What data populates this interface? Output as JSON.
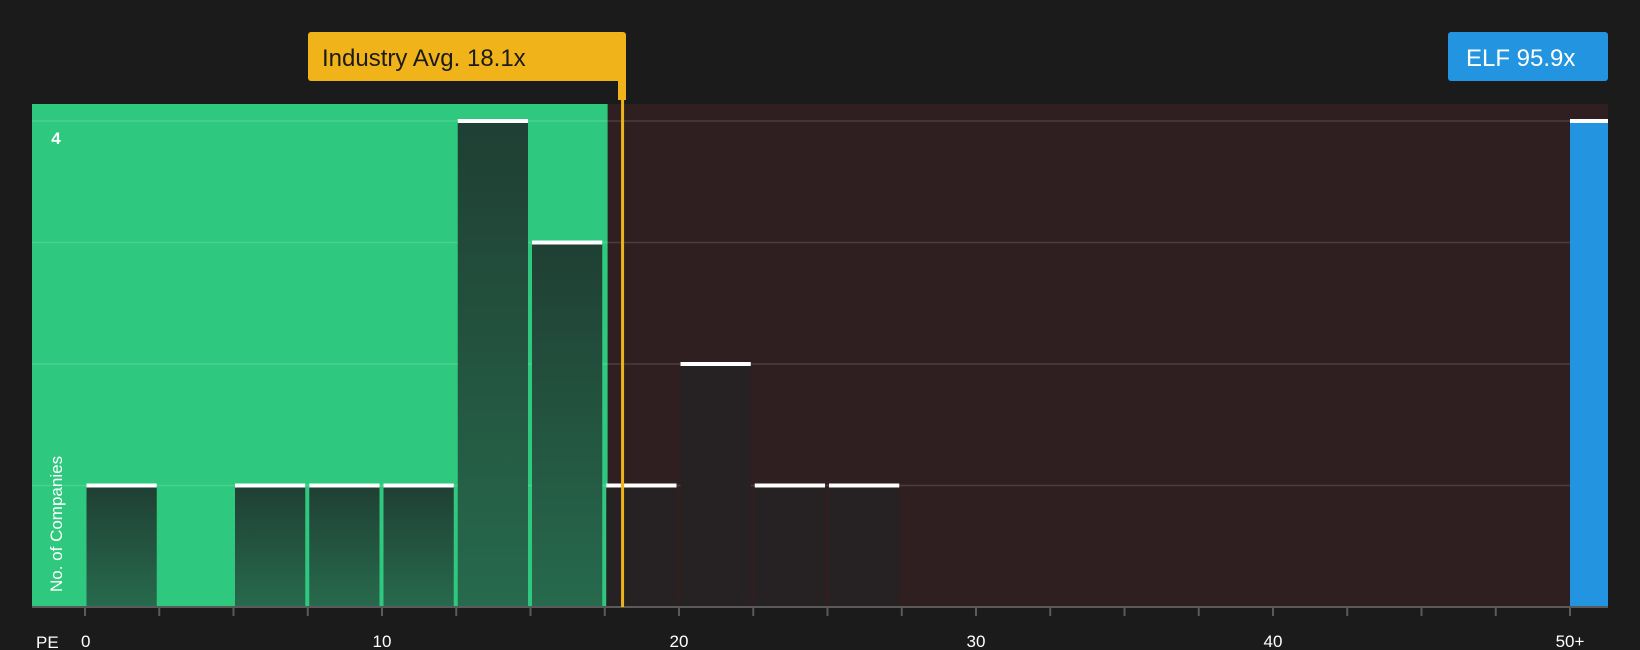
{
  "chart_data": {
    "type": "bar",
    "xlabel": "PE",
    "ylabel": "No. of Companies",
    "x_ticks": [
      {
        "value": 0,
        "label": "0"
      },
      {
        "value": 10,
        "label": "10"
      },
      {
        "value": 20,
        "label": "20"
      },
      {
        "value": 30,
        "label": "30"
      },
      {
        "value": 40,
        "label": "40"
      },
      {
        "value": 50,
        "label": "50+"
      }
    ],
    "xlim": [
      0,
      50
    ],
    "ylim": [
      0,
      4
    ],
    "y_tick_label": "4",
    "bin_width": 2.5,
    "bins": [
      {
        "start": 0,
        "count": 1
      },
      {
        "start": 2.5,
        "count": 0
      },
      {
        "start": 5,
        "count": 1
      },
      {
        "start": 7.5,
        "count": 1
      },
      {
        "start": 10,
        "count": 1
      },
      {
        "start": 12.5,
        "count": 4
      },
      {
        "start": 15,
        "count": 3
      },
      {
        "start": 17.5,
        "count": 1
      },
      {
        "start": 20,
        "count": 2
      },
      {
        "start": 22.5,
        "count": 1
      },
      {
        "start": 25,
        "count": 1
      }
    ],
    "highlight": {
      "label": "ELF 95.9x",
      "count": 4,
      "color": "#2394e0"
    },
    "industry_avg": {
      "label": "Industry Avg. 18.1x",
      "value": 18.1,
      "color": "#f0b31a"
    },
    "fair_zone_end": 17.5,
    "colors": {
      "background": "#1b1b1b",
      "fair_zone": "#2ec97e",
      "over_zone": "#2f1f20",
      "bar_fair": "#23483a",
      "bar_over": "#262122",
      "bar_top": "#ffffff"
    }
  }
}
